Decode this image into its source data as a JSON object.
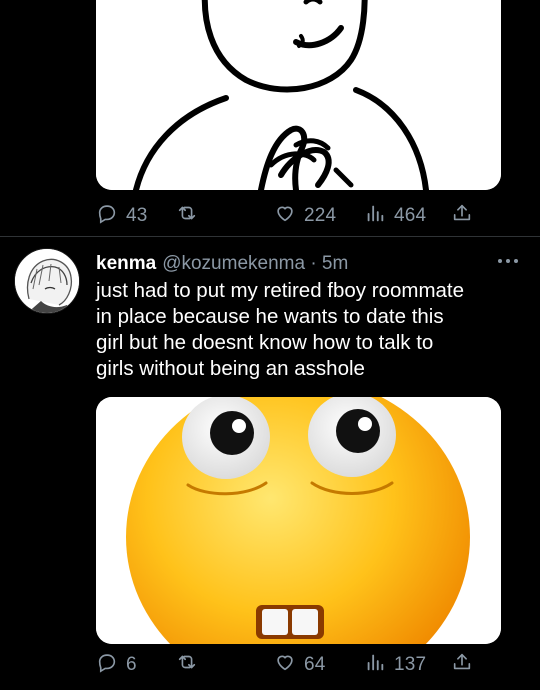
{
  "tweet_prev": {
    "actions": {
      "replies": "43",
      "retweets": "",
      "likes": "224",
      "views": "464"
    }
  },
  "tweet": {
    "display_name": "kenma",
    "handle_time": "@kozumekenma · 5m",
    "text_lines": [
      "just had to put my retired fboy roommate",
      "in place because he wants to date this",
      "girl but he doesnt know how to talk to",
      "girls without being an asshole"
    ],
    "actions": {
      "replies": "6",
      "retweets": "",
      "likes": "64",
      "views": "137"
    }
  },
  "icons": {
    "reply": "reply-icon",
    "retweet": "retweet-icon",
    "like": "heart-icon",
    "views": "analytics-icon",
    "share": "share-icon",
    "more": "more-options-icon"
  },
  "colors": {
    "background": "#000000",
    "text": "#ffffff",
    "muted": "#8b98a5",
    "divider": "#2f3336"
  }
}
